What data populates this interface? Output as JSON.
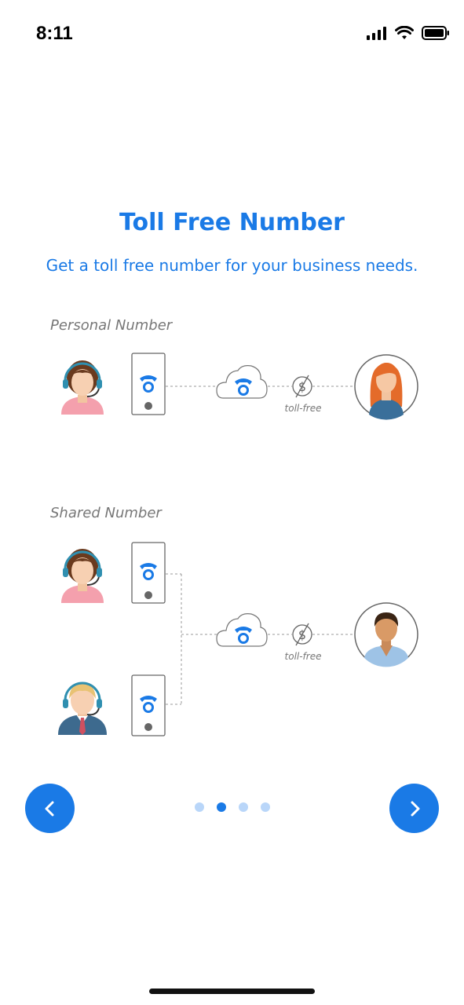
{
  "status": {
    "time": "8:11"
  },
  "title": "Toll Free Number",
  "subtitle": "Get a toll free number for your business needs.",
  "sections": {
    "personal": {
      "label": "Personal  Number",
      "toll_label": "toll-free"
    },
    "shared": {
      "label": "Shared Number",
      "toll_label": "toll-free"
    }
  },
  "pager": {
    "total": 4,
    "current": 2
  },
  "colors": {
    "accent": "#1a7ae6",
    "dot_inactive": "#b9d6f9"
  },
  "icons": [
    "signal-icon",
    "wifi-icon",
    "battery-icon",
    "chevron-left-icon",
    "chevron-right-icon",
    "phone-icon",
    "cloud-icon",
    "no-charge-icon"
  ]
}
